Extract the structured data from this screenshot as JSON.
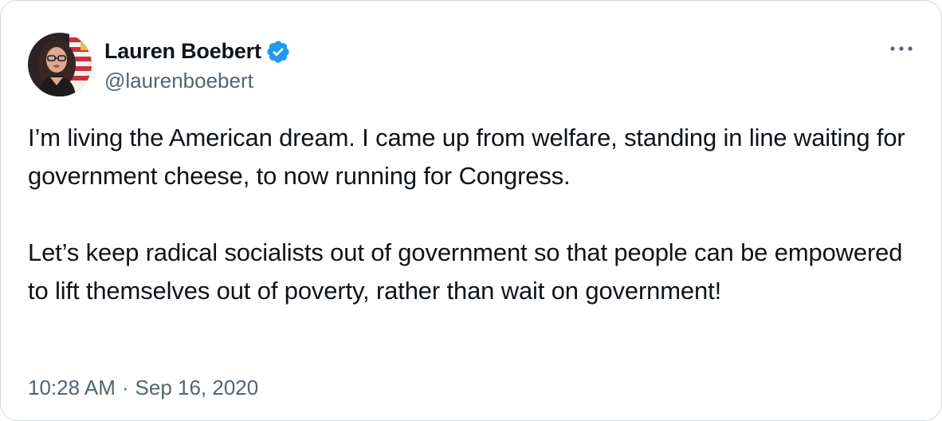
{
  "author": {
    "display_name": "Lauren Boebert",
    "handle": "@laurenboebert",
    "verified": true,
    "verified_icon": "verified-badge-icon",
    "avatar_icon": "avatar"
  },
  "tweet": {
    "paragraphs": [
      "I’m living the American dream. I came up from welfare, standing in line waiting for government cheese, to now running for Congress.",
      "Let’s keep radical socialists out of government so that people can be empowered to lift themselves out of poverty, rather than wait on government!"
    ],
    "time": "10:28 AM",
    "separator": "·",
    "date": "Sep 16, 2020"
  },
  "menu": {
    "icon": "more-options-icon"
  },
  "colors": {
    "text_primary": "#0f1419",
    "text_secondary": "#536471",
    "verified_blue": "#1d9bf0",
    "border": "#cfd9de"
  }
}
